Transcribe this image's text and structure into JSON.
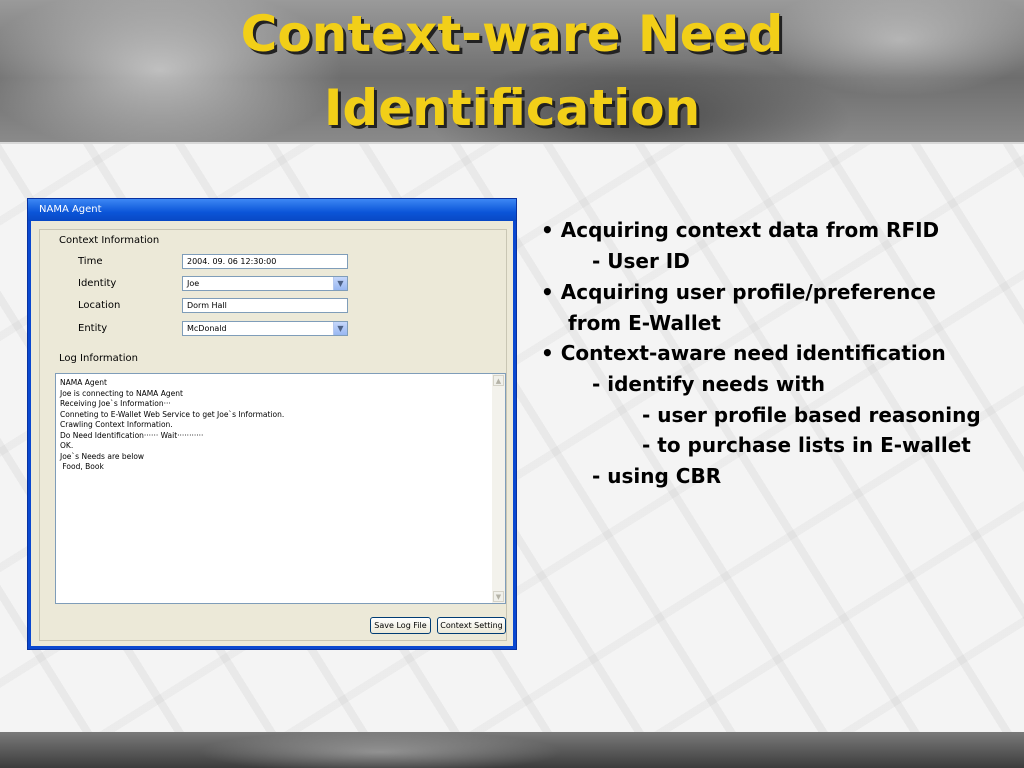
{
  "slide": {
    "title_line1": "Context-ware Need",
    "title_line2": "Identification"
  },
  "window": {
    "title": "NAMA Agent",
    "context_section": "Context Information",
    "fields": [
      {
        "label": "Time",
        "value": "2004. 09. 06 12:30:00",
        "type": "text"
      },
      {
        "label": "Identity",
        "value": "Joe",
        "type": "select"
      },
      {
        "label": "Location",
        "value": "Dorm Hall",
        "type": "text"
      },
      {
        "label": "Entity",
        "value": "McDonald",
        "type": "select"
      }
    ],
    "log_section": "Log Information",
    "log_lines": [
      "NAMA Agent",
      "Joe is connecting to NAMA Agent",
      "Receiving Joe`s Information···",
      "Conneting to E-Wallet Web Service to get Joe`s Information.",
      "Crawling Context Information.",
      "Do Need Identification······ Wait···········",
      "OK.",
      "Joe`s Needs are below",
      " Food, Book"
    ],
    "buttons": {
      "save_log": "Save Log File",
      "context_setting": "Context Setting"
    }
  },
  "bullets": [
    {
      "text": "• Acquiring context data from RFID"
    },
    {
      "text": "- User ID"
    },
    {
      "text": "• Acquiring user profile/preference"
    },
    {
      "text": "from E-Wallet"
    },
    {
      "text": "• Context-aware need identification"
    },
    {
      "text": "- identify needs with"
    },
    {
      "text": "- user profile based reasoning"
    },
    {
      "text": "- to purchase lists in E-wallet"
    },
    {
      "text": "- using CBR"
    }
  ],
  "colors": {
    "title": "#f2cf18",
    "window_frame": "#0a48d0",
    "window_client": "#ece9d8"
  }
}
